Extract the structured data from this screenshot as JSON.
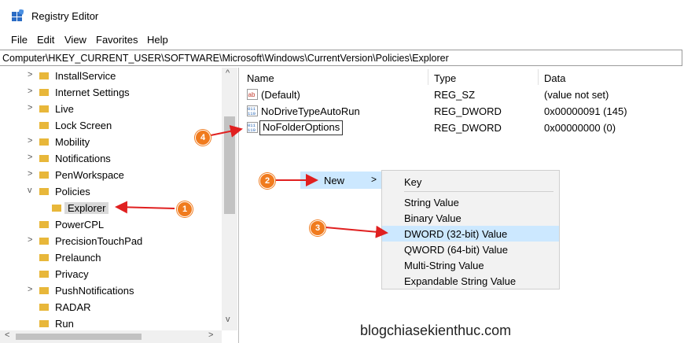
{
  "window": {
    "title": "Registry Editor",
    "app_icon": "registry-editor-icon"
  },
  "menu": [
    "File",
    "Edit",
    "View",
    "Favorites",
    "Help"
  ],
  "address": "Computer\\HKEY_CURRENT_USER\\SOFTWARE\\Microsoft\\Windows\\CurrentVersion\\Policies\\Explorer",
  "tree": {
    "items": [
      {
        "label": "InstallService",
        "chevron": ">"
      },
      {
        "label": "Internet Settings",
        "chevron": ">"
      },
      {
        "label": "Live",
        "chevron": ">"
      },
      {
        "label": "Lock Screen",
        "chevron": ""
      },
      {
        "label": "Mobility",
        "chevron": ">"
      },
      {
        "label": "Notifications",
        "chevron": ">"
      },
      {
        "label": "PenWorkspace",
        "chevron": ">"
      },
      {
        "label": "Policies",
        "chevron": "v"
      },
      {
        "label": "Explorer",
        "chevron": ""
      },
      {
        "label": "PowerCPL",
        "chevron": ""
      },
      {
        "label": "PrecisionTouchPad",
        "chevron": ">"
      },
      {
        "label": "Prelaunch",
        "chevron": ""
      },
      {
        "label": "Privacy",
        "chevron": ""
      },
      {
        "label": "PushNotifications",
        "chevron": ">"
      },
      {
        "label": "RADAR",
        "chevron": ""
      },
      {
        "label": "Run",
        "chevron": ""
      }
    ],
    "scroll_up": "^",
    "scroll_down": "v",
    "scroll_left": "<",
    "scroll_right": ">"
  },
  "columns": {
    "name": "Name",
    "type": "Type",
    "data": "Data"
  },
  "values": [
    {
      "name": "(Default)",
      "type": "REG_SZ",
      "data": "(value not set)",
      "icon": "string-value-icon"
    },
    {
      "name": "NoDriveTypeAutoRun",
      "type": "REG_DWORD",
      "data": "0x00000091 (145)",
      "icon": "binary-value-icon"
    },
    {
      "name": "NoFolderOptions",
      "type": "REG_DWORD",
      "data": "0x00000000 (0)",
      "icon": "binary-value-icon"
    }
  ],
  "context_menu": {
    "new_label": "New",
    "arrow": ">"
  },
  "submenu": {
    "key": "Key",
    "items": [
      "String Value",
      "Binary Value",
      "DWORD (32-bit) Value",
      "QWORD (64-bit) Value",
      "Multi-String Value",
      "Expandable String Value"
    ],
    "highlighted": "DWORD (32-bit) Value"
  },
  "steps": [
    "1",
    "2",
    "3",
    "4"
  ],
  "annotation_color": "#e02020",
  "badge_color": "#f07b1e",
  "watermark": "blogchiasekienthuc.com"
}
